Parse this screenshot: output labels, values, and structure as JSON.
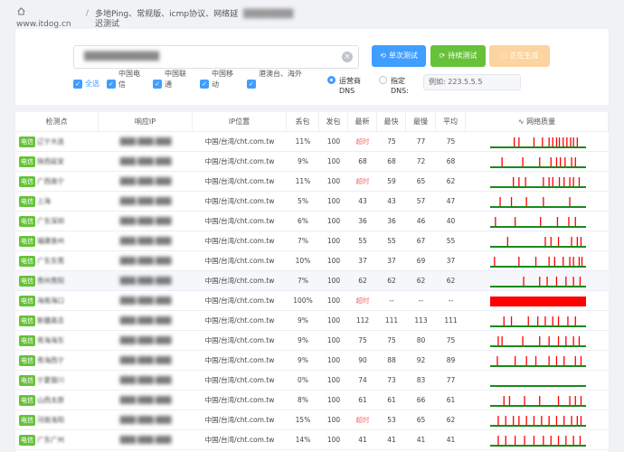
{
  "breadcrumb": {
    "site": "www.itdog.cn",
    "sep": "/",
    "item2": "多地Ping、常规版、icmp协议、网络延迟测试",
    "item3": "████████"
  },
  "search": {
    "value": "████████████",
    "clear": "×"
  },
  "buttons": {
    "single": "单次测试",
    "continuous": "持续测试",
    "generate": "正在生成"
  },
  "checkboxes": [
    {
      "label": "全选"
    },
    {
      "label": "中国电信"
    },
    {
      "label": "中国联通"
    },
    {
      "label": "中国移动"
    },
    {
      "label": "港澳台、海外"
    }
  ],
  "dns": {
    "isp_label": "运营商DNS",
    "custom_label": "指定DNS:",
    "input_placeholder": "例如: 223.5.5.5"
  },
  "table": {
    "headers": [
      "检测点",
      "响应IP",
      "IP位置",
      "丢包",
      "发包",
      "最新",
      "最快",
      "最慢",
      "平均",
      "网络质量"
    ],
    "isp_badge": "电信",
    "rows": [
      {
        "loc": "辽宁大连",
        "ip": "███.███.███",
        "ipLoc": "中国/台湾/cht.com.tw",
        "loss": "11%",
        "sent": "100",
        "latest": "超时",
        "fast": "75",
        "slow": "77",
        "avg": "75",
        "spikes": [
          0.25,
          0.3,
          0.46,
          0.55,
          0.62,
          0.66,
          0.7,
          0.73,
          0.77,
          0.81,
          0.85,
          0.88,
          0.92
        ]
      },
      {
        "loc": "陕西延安",
        "ip": "███.███.███",
        "ipLoc": "中国/台湾/cht.com.tw",
        "loss": "9%",
        "sent": "100",
        "latest": "68",
        "fast": "68",
        "slow": "72",
        "avg": "68",
        "spikes": [
          0.12,
          0.34,
          0.52,
          0.64,
          0.7,
          0.74,
          0.79,
          0.86,
          0.9
        ]
      },
      {
        "loc": "广西南宁",
        "ip": "███.███.███",
        "ipLoc": "中国/台湾/cht.com.tw",
        "loss": "11%",
        "sent": "100",
        "latest": "超时",
        "fast": "59",
        "slow": "65",
        "avg": "62",
        "spikes": [
          0.24,
          0.3,
          0.37,
          0.56,
          0.62,
          0.66,
          0.73,
          0.78,
          0.84,
          0.88,
          0.94
        ]
      },
      {
        "loc": "上海",
        "ip": "███.███.███",
        "ipLoc": "中国/台湾/cht.com.tw",
        "loss": "5%",
        "sent": "100",
        "latest": "43",
        "fast": "43",
        "slow": "57",
        "avg": "47",
        "spikes": [
          0.1,
          0.22,
          0.38,
          0.56,
          0.84
        ]
      },
      {
        "loc": "广东深圳",
        "ip": "███.███.███",
        "ipLoc": "中国/台湾/cht.com.tw",
        "loss": "6%",
        "sent": "100",
        "latest": "36",
        "fast": "36",
        "slow": "46",
        "avg": "40",
        "spikes": [
          0.05,
          0.26,
          0.53,
          0.71,
          0.83,
          0.9
        ]
      },
      {
        "loc": "福建泉州",
        "ip": "███.███.███",
        "ipLoc": "中国/台湾/cht.com.tw",
        "loss": "7%",
        "sent": "100",
        "latest": "55",
        "fast": "55",
        "slow": "67",
        "avg": "55",
        "spikes": [
          0.18,
          0.58,
          0.64,
          0.72,
          0.86,
          0.92,
          0.96
        ]
      },
      {
        "loc": "广东东莞",
        "ip": "███.███.███",
        "ipLoc": "中国/台湾/cht.com.tw",
        "loss": "10%",
        "sent": "100",
        "latest": "37",
        "fast": "37",
        "slow": "69",
        "avg": "37",
        "spikes": [
          0.04,
          0.3,
          0.48,
          0.62,
          0.68,
          0.77,
          0.84,
          0.88,
          0.94,
          0.97
        ]
      },
      {
        "loc": "贵州贵阳",
        "ip": "███.███.███",
        "ipLoc": "中国/台湾/cht.com.tw",
        "loss": "7%",
        "sent": "100",
        "latest": "62",
        "fast": "62",
        "slow": "62",
        "avg": "62",
        "spikes": [
          0.35,
          0.52,
          0.6,
          0.7,
          0.8,
          0.88,
          0.95
        ]
      },
      {
        "loc": "海南海口",
        "ip": "███.███.███",
        "ipLoc": "中国/台湾/cht.com.tw",
        "loss": "100%",
        "sent": "100",
        "latest": "超时",
        "fast": "--",
        "slow": "--",
        "avg": "--",
        "spikes": [],
        "full": true
      },
      {
        "loc": "新疆昌吉",
        "ip": "███.███.███",
        "ipLoc": "中国/台湾/cht.com.tw",
        "loss": "9%",
        "sent": "100",
        "latest": "112",
        "fast": "111",
        "slow": "113",
        "avg": "111",
        "spikes": [
          0.14,
          0.22,
          0.4,
          0.5,
          0.58,
          0.66,
          0.72,
          0.82,
          0.9
        ]
      },
      {
        "loc": "青海海东",
        "ip": "███.███.███",
        "ipLoc": "中国/台湾/cht.com.tw",
        "loss": "9%",
        "sent": "100",
        "latest": "75",
        "fast": "75",
        "slow": "80",
        "avg": "75",
        "spikes": [
          0.08,
          0.12,
          0.34,
          0.52,
          0.62,
          0.72,
          0.8,
          0.88,
          0.94
        ]
      },
      {
        "loc": "青海西宁",
        "ip": "███.███.███",
        "ipLoc": "中国/台湾/cht.com.tw",
        "loss": "9%",
        "sent": "100",
        "latest": "90",
        "fast": "88",
        "slow": "92",
        "avg": "89",
        "spikes": [
          0.07,
          0.26,
          0.38,
          0.48,
          0.62,
          0.7,
          0.78,
          0.9,
          0.96
        ]
      },
      {
        "loc": "宁夏银川",
        "ip": "███.███.███",
        "ipLoc": "中国/台湾/cht.com.tw",
        "loss": "0%",
        "sent": "100",
        "latest": "74",
        "fast": "73",
        "slow": "83",
        "avg": "77",
        "spikes": []
      },
      {
        "loc": "山西太原",
        "ip": "███.███.███",
        "ipLoc": "中国/台湾/cht.com.tw",
        "loss": "8%",
        "sent": "100",
        "latest": "61",
        "fast": "61",
        "slow": "66",
        "avg": "61",
        "spikes": [
          0.14,
          0.2,
          0.36,
          0.52,
          0.72,
          0.84,
          0.9,
          0.96
        ]
      },
      {
        "loc": "河南洛阳",
        "ip": "███.███.███",
        "ipLoc": "中国/台湾/cht.com.tw",
        "loss": "15%",
        "sent": "100",
        "latest": "超时",
        "fast": "53",
        "slow": "65",
        "avg": "62",
        "spikes": [
          0.08,
          0.16,
          0.24,
          0.3,
          0.38,
          0.46,
          0.54,
          0.62,
          0.7,
          0.78,
          0.86,
          0.92,
          0.96
        ]
      },
      {
        "loc": "广东广州",
        "ip": "███.███.███",
        "ipLoc": "中国/台湾/cht.com.tw",
        "loss": "14%",
        "sent": "100",
        "latest": "41",
        "fast": "41",
        "slow": "41",
        "avg": "41",
        "spikes": [
          0.08,
          0.16,
          0.26,
          0.36,
          0.46,
          0.56,
          0.64,
          0.72,
          0.8,
          0.88,
          0.95
        ]
      }
    ]
  },
  "colors": {
    "primary": "#409eff",
    "success": "#67c23a",
    "warning_light": "#fbd49f",
    "danger": "#f56c6c",
    "spark_good": "#1a8a1a",
    "spark_bad": "#ff0000"
  }
}
